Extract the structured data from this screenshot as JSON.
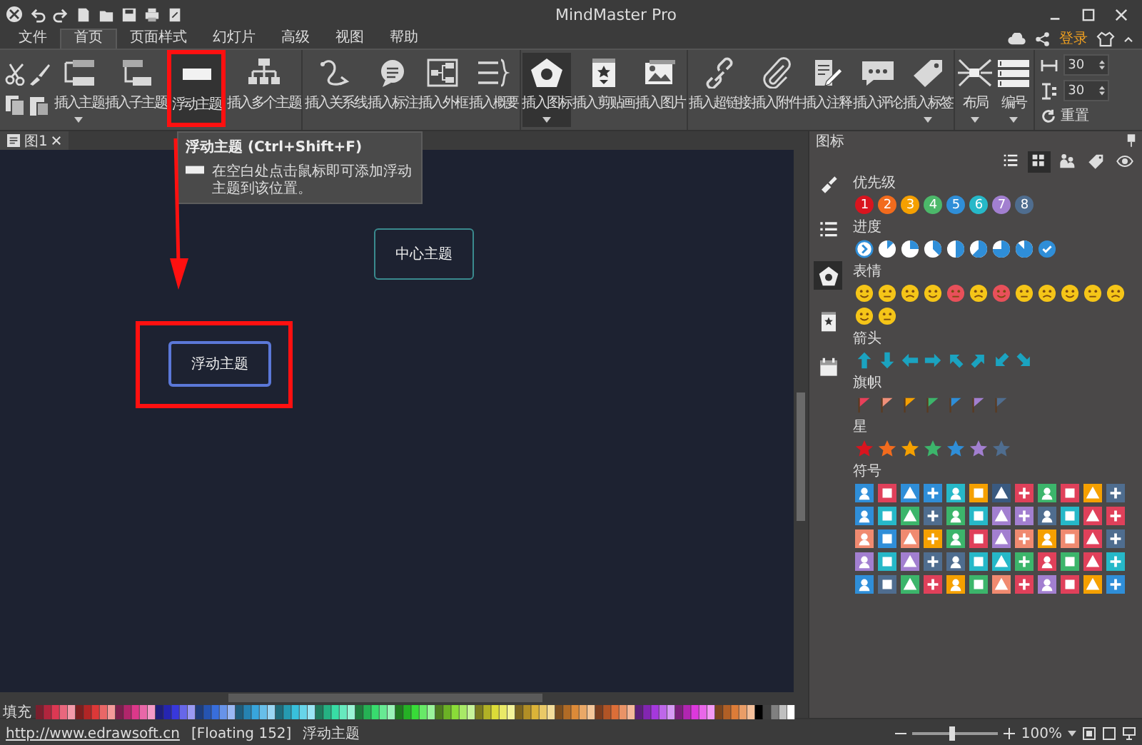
{
  "window": {
    "title": "MindMaster Pro"
  },
  "menu": {
    "tabs": [
      {
        "label": "文件",
        "selected": false
      },
      {
        "label": "首页",
        "selected": true
      },
      {
        "label": "页面样式",
        "selected": false
      },
      {
        "label": "幻灯片",
        "selected": false
      },
      {
        "label": "高级",
        "selected": false
      },
      {
        "label": "视图",
        "selected": false
      },
      {
        "label": "帮助",
        "selected": false
      }
    ],
    "login": "登录"
  },
  "ribbon": {
    "groups": [
      {
        "buttons": [
          {
            "kind": "topic",
            "label": "插入主题",
            "dropdown": true,
            "selected": false
          },
          {
            "kind": "subtopic",
            "label": "插入子主题",
            "dropdown": false,
            "selected": false
          },
          {
            "kind": "floating",
            "label": "浮动主题",
            "dropdown": false,
            "selected": true
          },
          {
            "kind": "multi",
            "label": "插入多个主题",
            "dropdown": false,
            "selected": false
          }
        ]
      },
      {
        "buttons": [
          {
            "kind": "relation",
            "label": "插入关系线",
            "dropdown": false,
            "selected": false
          },
          {
            "kind": "callout",
            "label": "插入标注",
            "dropdown": false,
            "selected": false
          },
          {
            "kind": "boundary",
            "label": "插入外框",
            "dropdown": false,
            "selected": false
          },
          {
            "kind": "summary",
            "label": "插入概要",
            "dropdown": false,
            "selected": false
          }
        ]
      },
      {
        "buttons": [
          {
            "kind": "icon",
            "label": "插入图标",
            "dropdown": true,
            "selected": true
          },
          {
            "kind": "clipart",
            "label": "插入剪贴画",
            "dropdown": false,
            "selected": false
          },
          {
            "kind": "image",
            "label": "插入图片",
            "dropdown": false,
            "selected": false
          }
        ]
      },
      {
        "buttons": [
          {
            "kind": "link",
            "label": "插入超链接",
            "dropdown": false,
            "selected": false
          },
          {
            "kind": "attach",
            "label": "插入附件",
            "dropdown": false,
            "selected": false
          },
          {
            "kind": "note",
            "label": "插入注释",
            "dropdown": false,
            "selected": false
          },
          {
            "kind": "comment",
            "label": "插入评论",
            "dropdown": false,
            "selected": false
          },
          {
            "kind": "tag",
            "label": "插入标签",
            "dropdown": true,
            "selected": false
          }
        ]
      },
      {
        "buttons": [
          {
            "kind": "layout",
            "label": "布局",
            "dropdown": true,
            "selected": false
          },
          {
            "kind": "numbering",
            "label": "编号",
            "dropdown": true,
            "selected": false
          }
        ]
      }
    ],
    "spinners": [
      {
        "kind": "width",
        "value": "30"
      },
      {
        "kind": "height",
        "value": "30"
      }
    ],
    "reset": "重置"
  },
  "tooltip": {
    "title": "浮动主题 (Ctrl+Shift+F)",
    "text": "在空白处点击鼠标即可添加浮动主题到该位置。"
  },
  "document_tabs": [
    {
      "label": "图1"
    }
  ],
  "canvas": {
    "topics": [
      {
        "kind": "central",
        "text": "中心主题",
        "selected": false
      },
      {
        "kind": "floating",
        "text": "浮动主题",
        "selected": true
      }
    ]
  },
  "palette": {
    "label": "填充"
  },
  "icon_panel": {
    "title": "图标",
    "side_tabs": [
      {
        "kind": "brush",
        "selected": false
      },
      {
        "kind": "list",
        "selected": false
      },
      {
        "kind": "icon",
        "selected": true
      },
      {
        "kind": "clipart",
        "selected": false
      },
      {
        "kind": "calendar",
        "selected": false
      }
    ],
    "view_buttons": [
      {
        "kind": "list",
        "selected": false
      },
      {
        "kind": "grid",
        "selected": true
      },
      {
        "kind": "people",
        "selected": false
      },
      {
        "kind": "tag",
        "selected": false
      },
      {
        "kind": "eye",
        "selected": false
      }
    ],
    "priority": {
      "label": "优先级",
      "items": [
        {
          "label": "1",
          "color": "#d9141e"
        },
        {
          "label": "2",
          "color": "#f26b1d"
        },
        {
          "label": "3",
          "color": "#f5a000"
        },
        {
          "label": "4",
          "color": "#4cb86a"
        },
        {
          "label": "5",
          "color": "#2f8ed8"
        },
        {
          "label": "6",
          "color": "#26b8c8"
        },
        {
          "label": "7",
          "color": "#a27fd0"
        },
        {
          "label": "8",
          "color": "#4f6d8f"
        }
      ]
    },
    "progress": {
      "label": "进度"
    },
    "faces": {
      "label": "表情"
    },
    "arrows": {
      "label": "箭头"
    },
    "flags": {
      "label": "旗帜",
      "items": [
        {
          "color": "#e8405a"
        },
        {
          "color": "#f0907a"
        },
        {
          "color": "#f5a000"
        },
        {
          "color": "#3cb56b"
        },
        {
          "color": "#2f8ed8"
        },
        {
          "color": "#a27fd0"
        },
        {
          "color": "#4f6d8f"
        }
      ]
    },
    "stars": {
      "label": "星",
      "items": [
        {
          "color": "#d9141e"
        },
        {
          "color": "#f26b1d"
        },
        {
          "color": "#f5a000"
        },
        {
          "color": "#3cb56b"
        },
        {
          "color": "#2f8ed8"
        },
        {
          "color": "#a27fd0"
        },
        {
          "color": "#4f6d8f"
        }
      ]
    },
    "symbols": {
      "label": "符号",
      "items": [
        {
          "color": "#2f8ed8"
        },
        {
          "color": "#e0405a"
        },
        {
          "color": "#2f8ed8"
        },
        {
          "color": "#2f8ed8"
        },
        {
          "color": "#26b8c8"
        },
        {
          "color": "#f5a000"
        },
        {
          "color": "#3a5a80"
        },
        {
          "color": "#e0405a"
        },
        {
          "color": "#3cb56b"
        },
        {
          "color": "#e0405a"
        },
        {
          "color": "#f5a000"
        },
        {
          "color": "#4f6d8f"
        },
        {
          "color": "#2f8ed8"
        },
        {
          "color": "#26b8c8"
        },
        {
          "color": "#3cb56b"
        },
        {
          "color": "#4f6d8f"
        },
        {
          "color": "#3cb56b"
        },
        {
          "color": "#26b8c8"
        },
        {
          "color": "#a27fd0"
        },
        {
          "color": "#a27fd0"
        },
        {
          "color": "#4f6d8f"
        },
        {
          "color": "#26b8c8"
        },
        {
          "color": "#e0405a"
        },
        {
          "color": "#e0405a"
        },
        {
          "color": "#f08a70"
        },
        {
          "color": "#2f8ed8"
        },
        {
          "color": "#f08a70"
        },
        {
          "color": "#f5a000"
        },
        {
          "color": "#3cb56b"
        },
        {
          "color": "#e0405a"
        },
        {
          "color": "#a27fd0"
        },
        {
          "color": "#f08a70"
        },
        {
          "color": "#f5a000"
        },
        {
          "color": "#f08a70"
        },
        {
          "color": "#e0405a"
        },
        {
          "color": "#4f6d8f"
        },
        {
          "color": "#a27fd0"
        },
        {
          "color": "#26b8c8"
        },
        {
          "color": "#a27fd0"
        },
        {
          "color": "#4f6d8f"
        },
        {
          "color": "#4f6d8f"
        },
        {
          "color": "#26b8c8"
        },
        {
          "color": "#26b8c8"
        },
        {
          "color": "#3cb56b"
        },
        {
          "color": "#e0405a"
        },
        {
          "color": "#3cb56b"
        },
        {
          "color": "#e0405a"
        },
        {
          "color": "#26b8c8"
        },
        {
          "color": "#2f8ed8"
        },
        {
          "color": "#4f6d8f"
        },
        {
          "color": "#3cb56b"
        },
        {
          "color": "#e0405a"
        },
        {
          "color": "#f5a000"
        },
        {
          "color": "#3cb56b"
        },
        {
          "color": "#f08a70"
        },
        {
          "color": "#e0405a"
        },
        {
          "color": "#a27fd0"
        },
        {
          "color": "#e0405a"
        },
        {
          "color": "#f5a000"
        },
        {
          "color": "#2f8ed8"
        }
      ]
    }
  },
  "status_bar": {
    "link": "http://www.edrawsoft.cn",
    "object": "[Floating 152]",
    "topic": "浮动主题",
    "zoom": {
      "level": 0.45,
      "reading": "100%"
    }
  }
}
